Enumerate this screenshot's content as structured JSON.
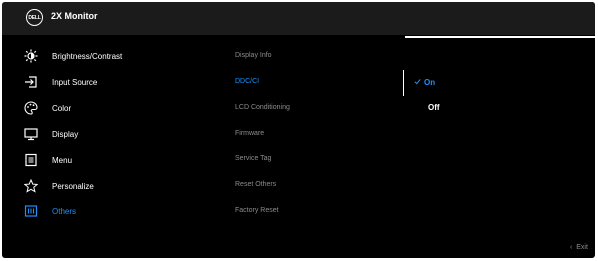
{
  "header": {
    "logo_text": "DELL",
    "title": "2X Monitor"
  },
  "menu": [
    {
      "label": "Brightness/Contrast",
      "icon": "brightness-icon"
    },
    {
      "label": "Input Source",
      "icon": "input-source-icon"
    },
    {
      "label": "Color",
      "icon": "color-palette-icon"
    },
    {
      "label": "Display",
      "icon": "display-icon"
    },
    {
      "label": "Menu",
      "icon": "menu-icon"
    },
    {
      "label": "Personalize",
      "icon": "star-icon"
    },
    {
      "label": "Others",
      "icon": "others-icon",
      "active": true
    }
  ],
  "submenu": [
    {
      "label": "Display Info"
    },
    {
      "label": "DDC/CI",
      "active": true
    },
    {
      "label": "LCD Conditioning"
    },
    {
      "label": "Firmware"
    },
    {
      "label": "Service Tag"
    },
    {
      "label": "Reset Others"
    },
    {
      "label": "Factory Reset"
    }
  ],
  "options": {
    "on": {
      "label": "On",
      "selected": true
    },
    "off": {
      "label": "Off",
      "selected": false
    }
  },
  "footer": {
    "exit_label": "Exit"
  },
  "colors": {
    "accent": "#1e90ff",
    "background": "#000000",
    "text": "#ffffff",
    "muted": "#8c8c8c"
  }
}
